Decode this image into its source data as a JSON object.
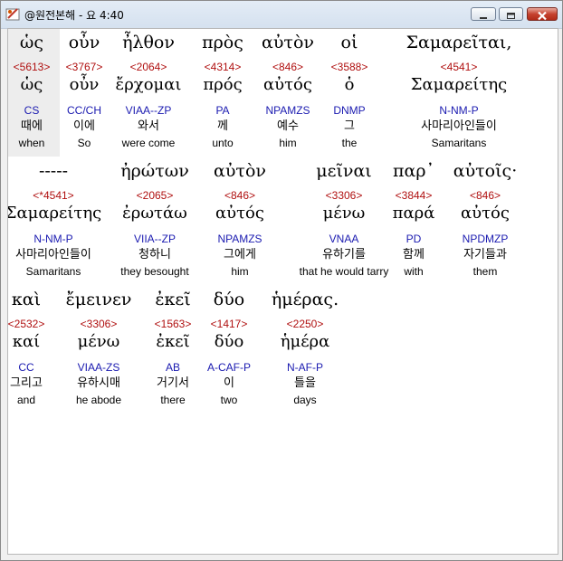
{
  "window": {
    "title": "@원전본해 - 요 4:40"
  },
  "colors": {
    "strongs_number": "#b01010",
    "parsing_code": "#1a1ab0",
    "text": "#000000"
  },
  "lines": [
    {
      "words": [
        {
          "greek": "ὡς",
          "strongs": "<5613>",
          "lemma": "ὡς",
          "parsing": "CS",
          "korean": "때에",
          "english": "when"
        },
        {
          "greek": "οὖν",
          "strongs": "<3767>",
          "lemma": "οὖν",
          "parsing": "CC/CH",
          "korean": "이에",
          "english": "So"
        },
        {
          "greek": "ἦλθον",
          "strongs": "<2064>",
          "lemma": "ἔρχομαι",
          "parsing": "VIAA--ZP",
          "korean": "와서",
          "english": "were come"
        },
        {
          "greek": "πρὸς",
          "strongs": "<4314>",
          "lemma": "πρός",
          "parsing": "PA",
          "korean": "께",
          "english": "unto"
        },
        {
          "greek": "αὐτὸν",
          "strongs": "<846>",
          "lemma": "αὐτός",
          "parsing": "NPAMZS",
          "korean": "예수",
          "english": "him"
        },
        {
          "greek": "οἱ",
          "strongs": "<3588>",
          "lemma": "ὁ",
          "parsing": "DNMP",
          "korean": "그",
          "english": "the"
        },
        {
          "greek": "Σαμαρεῖται,",
          "strongs": "<4541>",
          "lemma": "Σαμαρείτης",
          "parsing": "N-NM-P",
          "korean": "사마리아인들이",
          "english": "Samaritans"
        }
      ]
    },
    {
      "words": [
        {
          "greek": "-----",
          "strongs": "<*4541>",
          "lemma": "Σαμαρείτης",
          "parsing": "N-NM-P",
          "korean": "사마리아인들이",
          "english": "Samaritans"
        },
        {
          "greek": "ἠρώτων",
          "strongs": "<2065>",
          "lemma": "ἐρωτάω",
          "parsing": "VIIA--ZP",
          "korean": "청하니",
          "english": "they besought"
        },
        {
          "greek": "αὐτὸν",
          "strongs": "<846>",
          "lemma": "αὐτός",
          "parsing": "NPAMZS",
          "korean": "그에게",
          "english": "him"
        },
        {
          "greek": "μεῖναι",
          "strongs": "<3306>",
          "lemma": "μένω",
          "parsing": "VNAA",
          "korean": "유하기를",
          "english": "that he would tarry"
        },
        {
          "greek": "παρ᾽",
          "strongs": "<3844>",
          "lemma": "παρά",
          "parsing": "PD",
          "korean": "함께",
          "english": "with"
        },
        {
          "greek": "αὐτοῖς·",
          "strongs": "<846>",
          "lemma": "αὐτός",
          "parsing": "NPDMZP",
          "korean": "자기들과",
          "english": "them"
        }
      ]
    },
    {
      "words": [
        {
          "greek": "καὶ",
          "strongs": "<2532>",
          "lemma": "καί",
          "parsing": "CC",
          "korean": "그리고",
          "english": "and"
        },
        {
          "greek": "ἔμεινεν",
          "strongs": "<3306>",
          "lemma": "μένω",
          "parsing": "VIAA-ZS",
          "korean": "유하시매",
          "english": "he abode"
        },
        {
          "greek": "ἐκεῖ",
          "strongs": "<1563>",
          "lemma": "ἐκεῖ",
          "parsing": "AB",
          "korean": "거기서",
          "english": "there"
        },
        {
          "greek": "δύο",
          "strongs": "<1417>",
          "lemma": "δύο",
          "parsing": "A-CAF-P",
          "korean": "이",
          "english": "two"
        },
        {
          "greek": "ἡμέρας.",
          "strongs": "<2250>",
          "lemma": "ἡμέρα",
          "parsing": "N-AF-P",
          "korean": "틀을",
          "english": "days"
        }
      ]
    }
  ]
}
